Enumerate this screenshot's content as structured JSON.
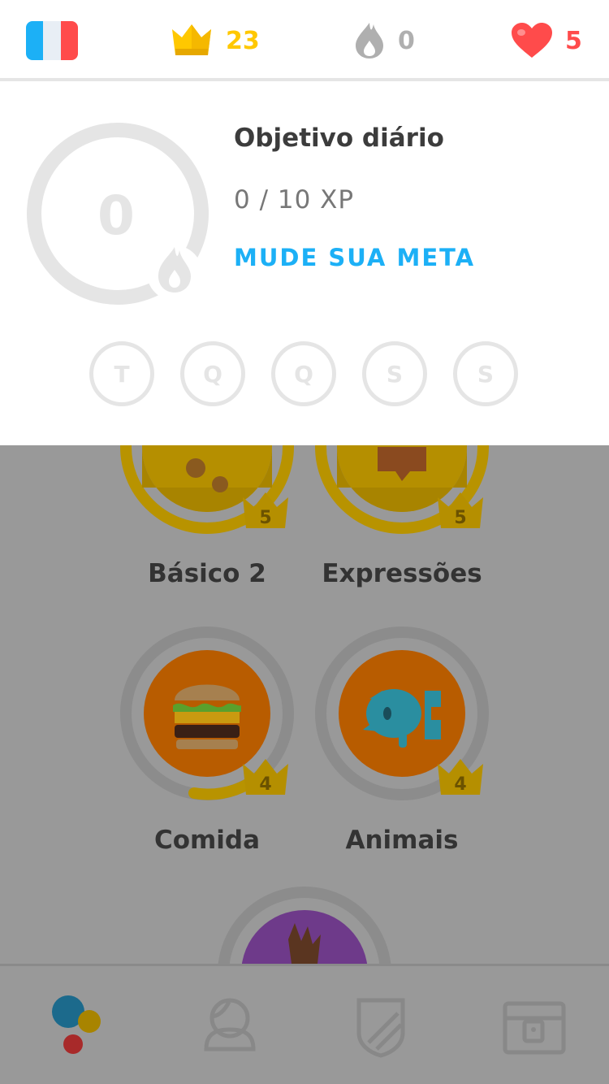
{
  "topbar": {
    "language_flag": "france-flag-icon",
    "crowns": "23",
    "streak": "0",
    "hearts": "5"
  },
  "goal": {
    "ring_value": "0",
    "title": "Objetivo diário",
    "progress": "0 / 10 XP",
    "progress_fraction": 0,
    "change_link": "MUDE SUA META",
    "days": [
      "T",
      "Q",
      "Q",
      "S",
      "S"
    ]
  },
  "skills": [
    {
      "name": "Básico 2",
      "level": "5"
    },
    {
      "name": "Expressões",
      "level": "5"
    },
    {
      "name": "Comida",
      "level": "4"
    },
    {
      "name": "Animais",
      "level": "4"
    }
  ],
  "nav": {
    "items": [
      "learn-tab",
      "profile-tab",
      "leagues-tab",
      "shop-tab"
    ]
  },
  "colors": {
    "crown": "#ffc800",
    "heart": "#ff4b4b",
    "link": "#1cb0f6",
    "overlay": "#999999"
  }
}
